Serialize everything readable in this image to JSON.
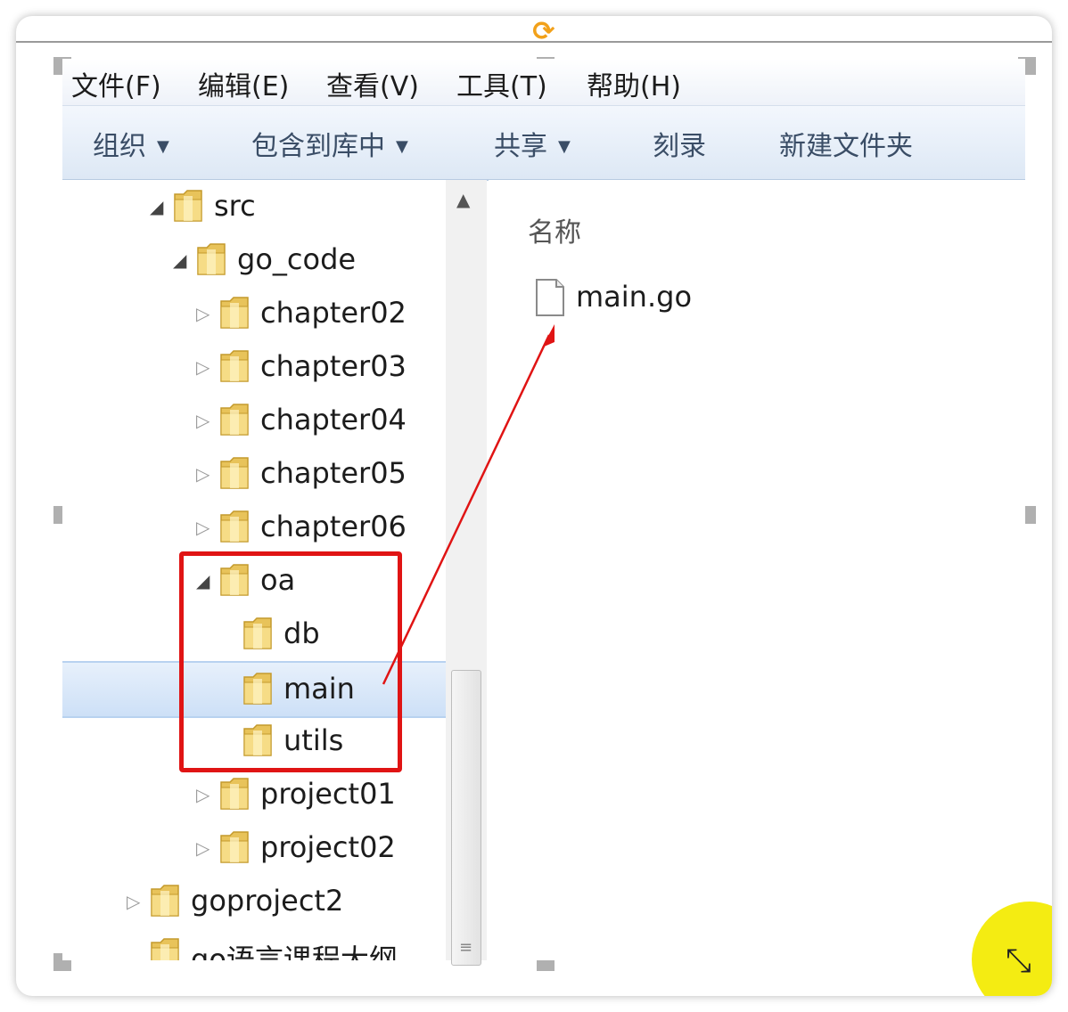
{
  "menubar": {
    "items": [
      {
        "label": "文件(F)"
      },
      {
        "label": "编辑(E)"
      },
      {
        "label": "查看(V)"
      },
      {
        "label": "工具(T)"
      },
      {
        "label": "帮助(H)"
      }
    ]
  },
  "toolbar": {
    "organize": "组织",
    "include_in_library": "包含到库中",
    "share": "共享",
    "burn": "刻录",
    "new_folder": "新建文件夹"
  },
  "tree": {
    "items": [
      {
        "label": "src",
        "state": "expanded"
      },
      {
        "label": "go_code",
        "state": "expanded"
      },
      {
        "label": "chapter02",
        "state": "collapsed"
      },
      {
        "label": "chapter03",
        "state": "collapsed"
      },
      {
        "label": "chapter04",
        "state": "collapsed"
      },
      {
        "label": "chapter05",
        "state": "collapsed"
      },
      {
        "label": "chapter06",
        "state": "collapsed"
      },
      {
        "label": "oa",
        "state": "expanded"
      },
      {
        "label": "db",
        "state": "none"
      },
      {
        "label": "main",
        "state": "none",
        "selected": true
      },
      {
        "label": "utils",
        "state": "none"
      },
      {
        "label": "project01",
        "state": "collapsed"
      },
      {
        "label": "project02",
        "state": "collapsed"
      },
      {
        "label": "goproject2",
        "state": "collapsed"
      },
      {
        "label": "go语言课程大纲",
        "state": "none"
      }
    ]
  },
  "content": {
    "column_header": "名称",
    "files": [
      {
        "name": "main.go",
        "icon": "file-icon"
      }
    ]
  },
  "annotations": {
    "highlight_color": "#e01414",
    "cursor_color": "#f4ec12"
  }
}
